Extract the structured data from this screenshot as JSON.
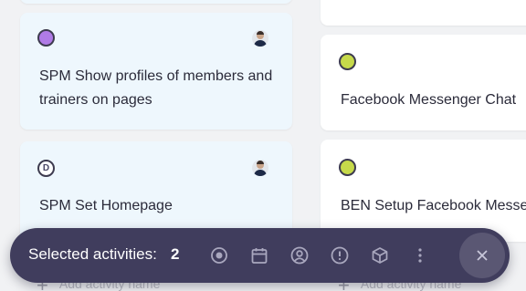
{
  "cards": [
    {
      "title": "SPM Show profiles of members and",
      "title_line2": "trainers on pages",
      "status_icon": "purple-status-dot",
      "selected": true
    },
    {
      "title": "SPM Set Homepage",
      "status_icon": "d-status-badge",
      "badge_letter": "D",
      "selected": true
    },
    {
      "title": "Facebook Messenger Chat",
      "status_icon": "green-status-dot",
      "selected": false
    },
    {
      "title": "BEN Setup Facebook Messer",
      "status_icon": "green-status-dot",
      "selected": false
    }
  ],
  "add_activity": {
    "left_placeholder": "Add activity name",
    "right_placeholder": "Add activity name"
  },
  "action_bar": {
    "label": "Selected activities:",
    "count": "2",
    "icons": [
      "status-icon",
      "calendar-icon",
      "assignee-icon",
      "priority-icon",
      "package-icon",
      "more-icon"
    ],
    "close_icon": "close-icon"
  },
  "colors": {
    "selected_card": "#eef7fd",
    "action_bar": "#403d5d",
    "purple_status": "#b07be6",
    "green_status": "#c6d94a"
  }
}
